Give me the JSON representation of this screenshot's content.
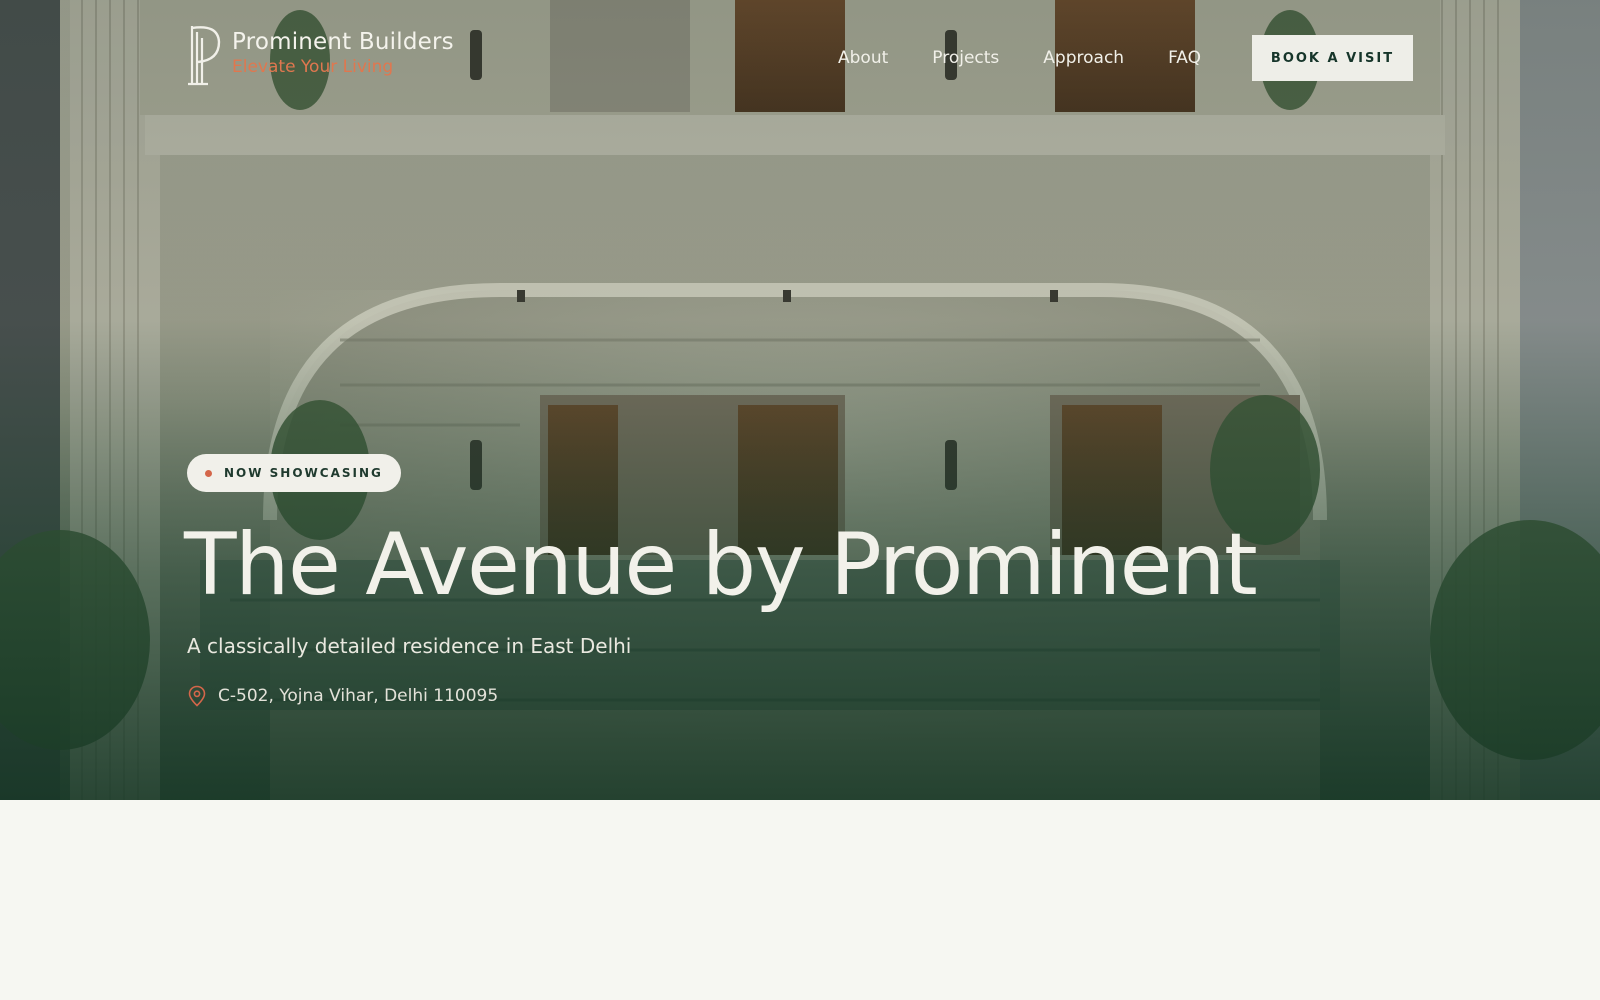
{
  "brand": {
    "name": "Prominent Builders",
    "tagline": "Elevate Your Living",
    "logo_icon": "p-column-logo-icon"
  },
  "nav": {
    "links": [
      {
        "label": "About"
      },
      {
        "label": "Projects"
      },
      {
        "label": "Approach"
      },
      {
        "label": "FAQ"
      }
    ],
    "cta_label": "BOOK A VISIT"
  },
  "hero": {
    "badge": "NOW SHOWCASING",
    "title": "The Avenue by Prominent",
    "subtitle": "A classically detailed residence in East Delhi",
    "address": "C-502, Yojna Vihar, Delhi 110095",
    "address_icon": "location-pin-icon"
  },
  "colors": {
    "accent": "#d4664a",
    "primary_dark": "#16352a",
    "page_background": "#f6f7f2",
    "text_light": "#f2f1ea"
  }
}
